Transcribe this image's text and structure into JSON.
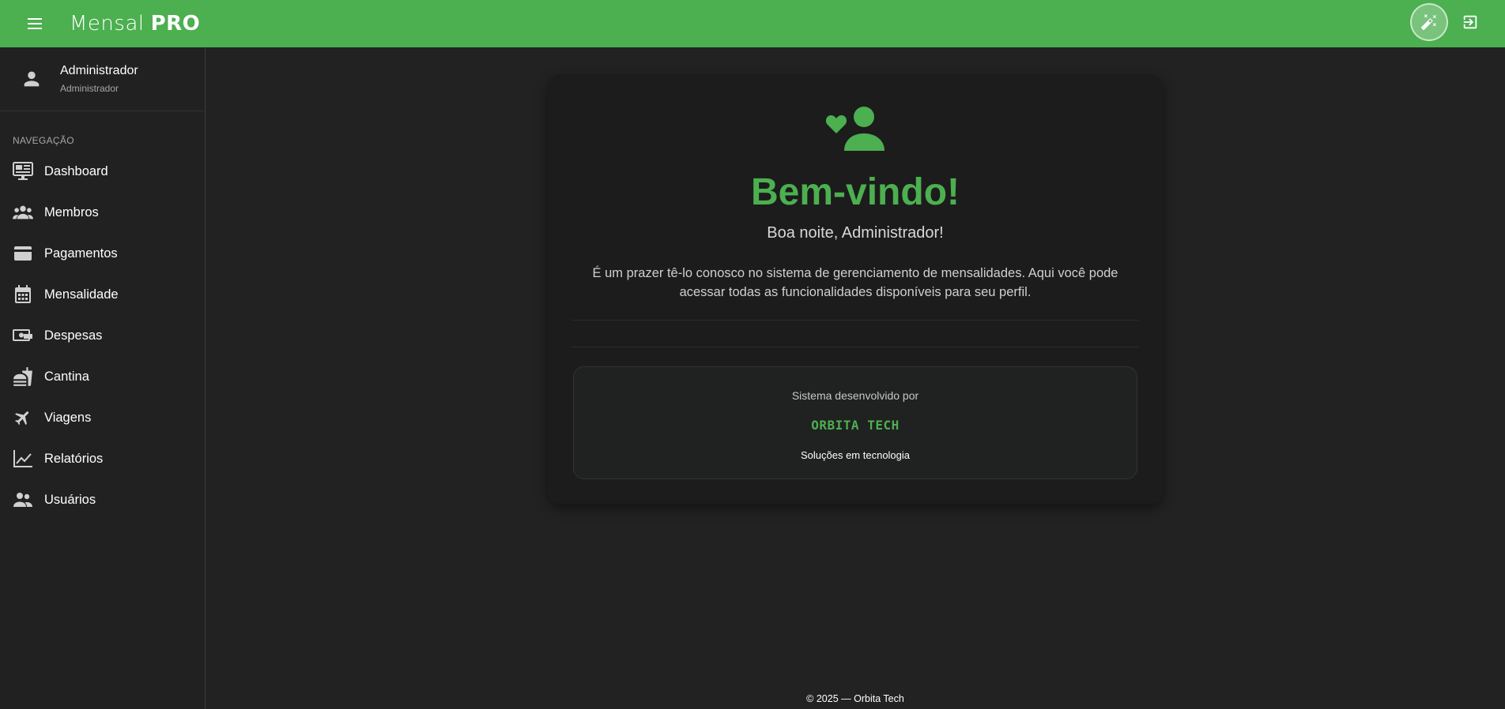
{
  "app": {
    "brand_light": "Mensal",
    "brand_bold": "PRO",
    "accent_color": "#4caf50"
  },
  "topbar": {
    "menu_icon": "menu-icon",
    "theme_icon": "theme-toggle-icon",
    "logout_icon": "logout-icon"
  },
  "user": {
    "name": "Administrador",
    "role": "Administrador"
  },
  "sidebar": {
    "section_title": "NAVEGAÇÃO",
    "items": [
      {
        "label": "Dashboard",
        "icon": "dashboard-icon"
      },
      {
        "label": "Membros",
        "icon": "members-icon"
      },
      {
        "label": "Pagamentos",
        "icon": "credit-card-icon"
      },
      {
        "label": "Mensalidade",
        "icon": "calendar-icon"
      },
      {
        "label": "Despesas",
        "icon": "money-icon"
      },
      {
        "label": "Cantina",
        "icon": "fastfood-icon"
      },
      {
        "label": "Viagens",
        "icon": "airplane-icon"
      },
      {
        "label": "Relatórios",
        "icon": "chart-icon"
      },
      {
        "label": "Usuários",
        "icon": "users-icon"
      }
    ]
  },
  "welcome": {
    "icon": "user-heart-icon",
    "title": "Bem-vindo!",
    "greeting": "Boa noite, Administrador!",
    "intro": "É um prazer tê-lo conosco no sistema de gerenciamento de mensalidades. Aqui você pode acessar todas as funcionalidades disponíveis para seu perfil."
  },
  "credits": {
    "label": "Sistema desenvolvido por",
    "company": "ORBITA TECH",
    "tagline": "Soluções em tecnologia"
  },
  "footer": {
    "text": "© 2025 — Orbita Tech"
  }
}
